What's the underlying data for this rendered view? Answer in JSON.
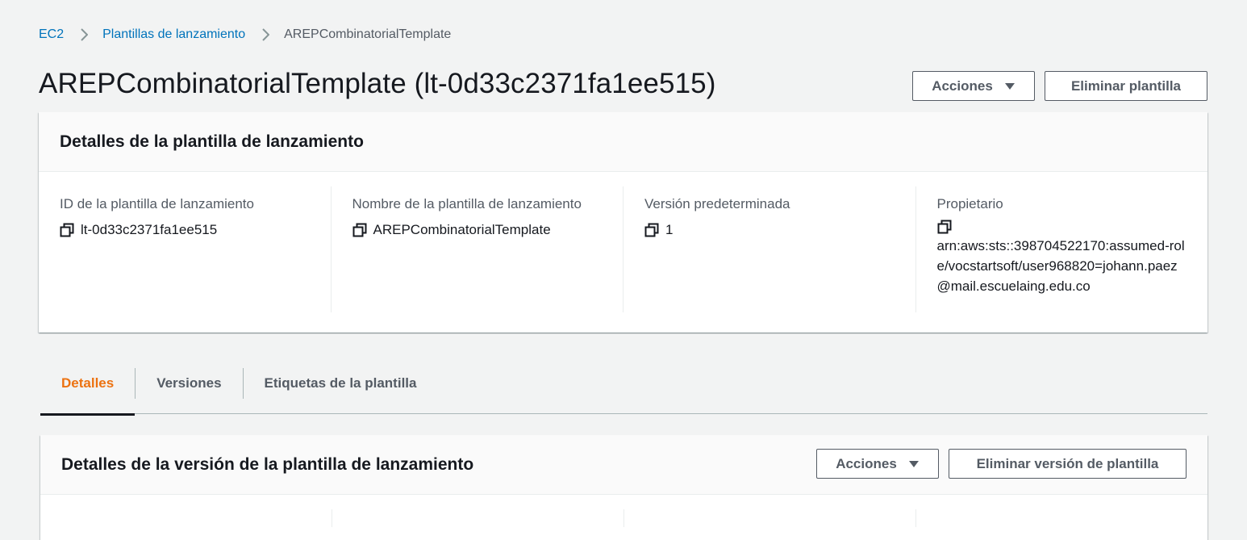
{
  "breadcrumb": {
    "root": "EC2",
    "section": "Plantillas de lanzamiento",
    "current": "AREPCombinatorialTemplate"
  },
  "page": {
    "title": "AREPCombinatorialTemplate (lt-0d33c2371fa1ee515)",
    "actions_label": "Acciones",
    "delete_label": "Eliminar plantilla"
  },
  "details_panel": {
    "title": "Detalles de la plantilla de lanzamiento",
    "fields": [
      {
        "label": "ID de la plantilla de lanzamiento",
        "value": "lt-0d33c2371fa1ee515"
      },
      {
        "label": "Nombre de la plantilla de lanzamiento",
        "value": "AREPCombinatorialTemplate"
      },
      {
        "label": "Versión predeterminada",
        "value": "1"
      },
      {
        "label": "Propietario",
        "value": "arn:aws:sts::398704522170:assumed-role/vocstartsoft/user968820=johann.paez@mail.escuelaing.edu.co"
      }
    ]
  },
  "tabs": [
    {
      "label": "Detalles",
      "active": true
    },
    {
      "label": "Versiones",
      "active": false
    },
    {
      "label": "Etiquetas de la plantilla",
      "active": false
    }
  ],
  "version_panel": {
    "title": "Detalles de la versión de la plantilla de lanzamiento",
    "actions_label": "Acciones",
    "delete_label": "Eliminar versión de plantilla"
  },
  "icons": {
    "breadcrumb_separator": "chevron-right-icon",
    "copy": "copy-icon",
    "dropdown": "caret-down-icon"
  },
  "colors": {
    "link": "#0073bb",
    "active_tab": "#ec7211",
    "text": "#16191f",
    "muted": "#545b64",
    "background": "#f2f3f3"
  }
}
